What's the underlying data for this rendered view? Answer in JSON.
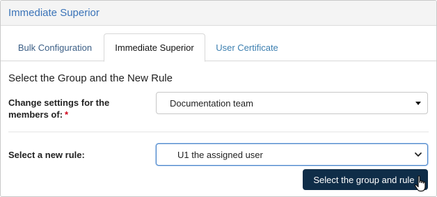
{
  "header": {
    "title": "Immediate Superior"
  },
  "tabs": [
    {
      "label": "Bulk Configuration",
      "active": false
    },
    {
      "label": "Immediate Superior",
      "active": true
    },
    {
      "label": "User Certificate",
      "active": false
    }
  ],
  "form": {
    "section_title": "Select the Group and the New Rule",
    "group_label": "Change settings for the members of:",
    "required_marker": "*",
    "group_value": "Documentation team",
    "rule_label": "Select a new rule:",
    "rule_value": "U1 the assigned user",
    "submit_label": "Select the group and rule"
  },
  "icons": {
    "group_caret": "caret-down-icon",
    "rule_chevron": "chevron-down-icon",
    "cursor": "hand-pointer-icon"
  },
  "colors": {
    "header_title": "#3a73b8",
    "button_bg": "#0f2d48",
    "required": "#d0021b",
    "focus_border": "#4b85c9"
  }
}
